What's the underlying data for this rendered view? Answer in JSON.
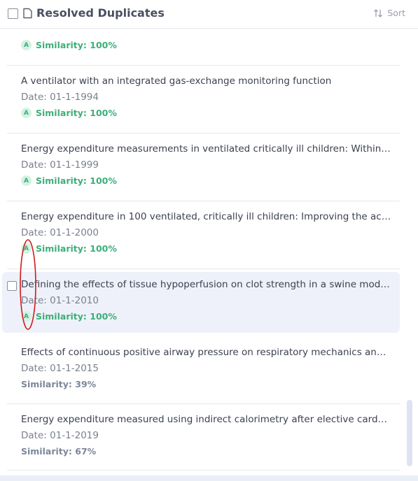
{
  "header": {
    "title": "Resolved Duplicates",
    "sort_label": "Sort"
  },
  "items": [
    {
      "title": "",
      "date": "",
      "similarity": "Similarity: 100%",
      "badge": "A"
    },
    {
      "title": "A ventilator with an integrated gas-exchange monitoring function",
      "date": "Date: 01-1-1994",
      "similarity": "Similarity: 100%",
      "badge": "A"
    },
    {
      "title": "Energy expenditure measurements in ventilated critically ill children: Within…",
      "date": "Date: 01-1-1999",
      "similarity": "Similarity: 100%",
      "badge": "A"
    },
    {
      "title": "Energy expenditure in 100 ventilated, critically ill children: Improving the acc…",
      "date": "Date: 01-1-2000",
      "similarity": "Similarity: 100%",
      "badge": "A"
    },
    {
      "title": "Defining the effects of tissue hypoperfusion on clot strength in a swine mod…",
      "date": "Date: 01-1-2010",
      "similarity": "Similarity: 100%",
      "badge": "A"
    },
    {
      "title": "Effects of continuous positive airway pressure on respiratory mechanics an…",
      "date": "Date: 01-1-2015",
      "similarity": "Similarity: 39%"
    },
    {
      "title": "Energy expenditure measured using indirect calorimetry after elective card…",
      "date": "Date: 01-1-2019",
      "similarity": "Similarity: 67%"
    }
  ],
  "colors": {
    "similarity_high": "#3dae79",
    "similarity_low": "#7c8798",
    "annotation": "#d11a1a"
  }
}
